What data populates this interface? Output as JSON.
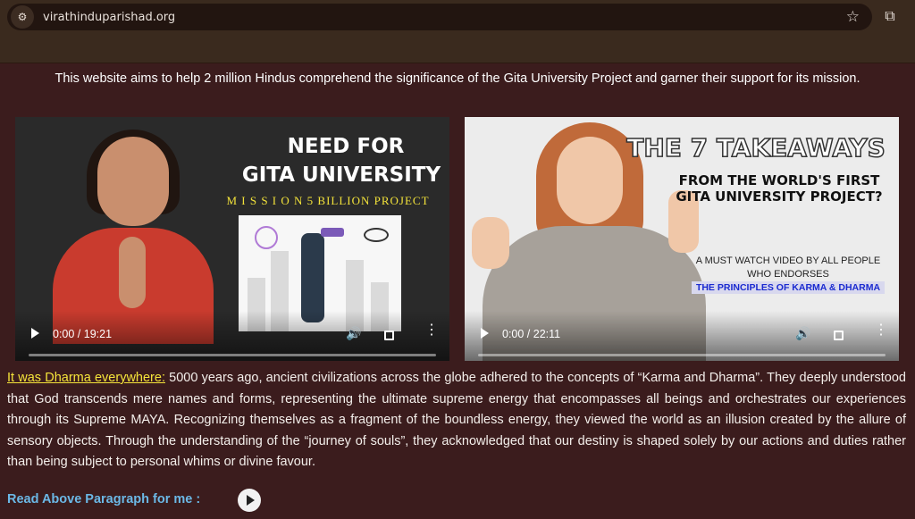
{
  "browser": {
    "url": "virathinduparishad.org",
    "site_info_icon": "tune-icon",
    "star_icon": "star-icon",
    "extensions_icon": "puzzle-icon"
  },
  "tagline": "This website aims to help 2 million Hindus comprehend the significance of the Gita University Project and garner their support for its mission.",
  "videos": [
    {
      "title_line1": "NEED FOR",
      "title_line2": "GITA UNIVERSITY",
      "subtitle": "M I S S I O N 5 BILLION PROJECT",
      "time": "0:00 / 19:21"
    },
    {
      "title_line1": "THE 7 TAKEAWAYS",
      "title_line2": "FROM THE WORLD'S FIRST GITA UNIVERSITY PROJECT?",
      "subtitle": "A MUST WATCH VIDEO BY ALL PEOPLE WHO ENDORSES",
      "highlight": "THE PRINCIPLES OF KARMA & DHARMA",
      "time": "0:00 / 22:11"
    }
  ],
  "article": {
    "lead": "It was Dharma everywhere:",
    "body": " 5000 years ago, ancient civilizations across the globe adhered to the concepts of “Karma and Dharma”. They deeply understood that God transcends mere names and forms, representing the ultimate supreme energy that encompasses all beings and orchestrates our experiences through its Supreme MAYA. Recognizing themselves as a fragment of the boundless energy, they viewed the world as an illusion created by the allure of sensory objects. Through the understanding of the “journey of souls”, they acknowledged that our destiny is shaped solely by our actions and duties rather than being subject to personal whims or divine favour."
  },
  "read_aloud": {
    "label": "Read Above Paragraph for me :"
  },
  "colors": {
    "background": "#3b1c1d",
    "lead_text": "#f5e43a",
    "read_label": "#6bb8e6"
  }
}
